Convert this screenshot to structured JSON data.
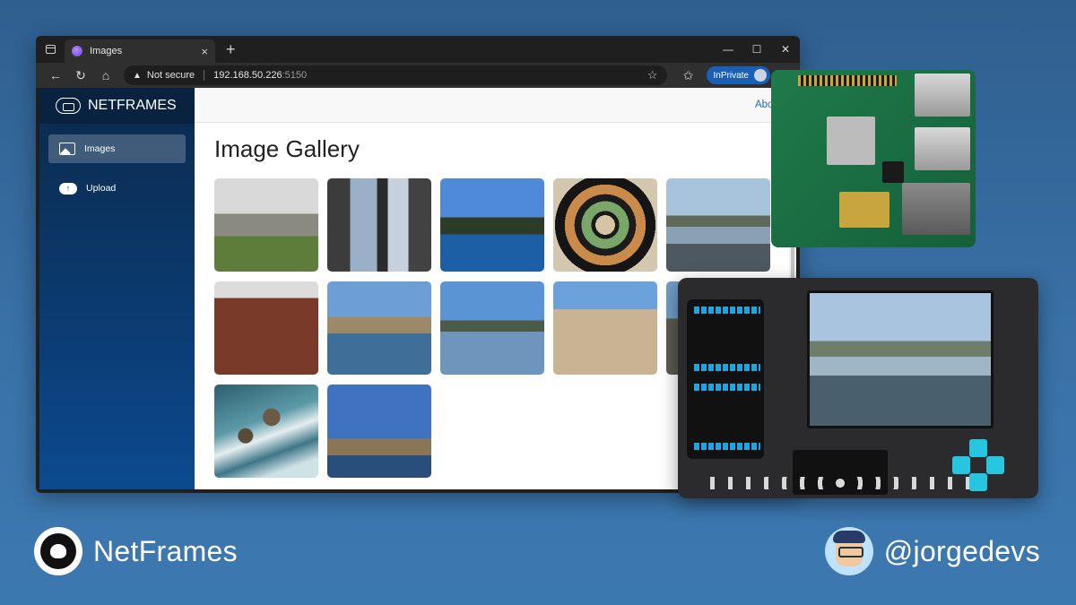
{
  "browser": {
    "tab_title": "Images",
    "tab_close": "×",
    "new_tab": "+",
    "address": {
      "security_label": "Not secure",
      "host": "192.168.50.226",
      "port": ":5150"
    },
    "inprivate_label": "InPrivate"
  },
  "app": {
    "brand": "NETFRAMES",
    "nav": [
      {
        "label": "Images",
        "icon": "image-icon",
        "active": true
      },
      {
        "label": "Upload",
        "icon": "cloud-upload-icon",
        "active": false
      }
    ],
    "top_link": "About",
    "page_title": "Image Gallery"
  },
  "gallery": {
    "count": 12
  },
  "footer": {
    "left_text": "NetFrames",
    "right_text": "@jorgedevs"
  },
  "colors": {
    "background": "#3a72a8",
    "sidebar": "#0b3c73",
    "link": "#1b6ec2",
    "accent": "#27c6e0"
  }
}
